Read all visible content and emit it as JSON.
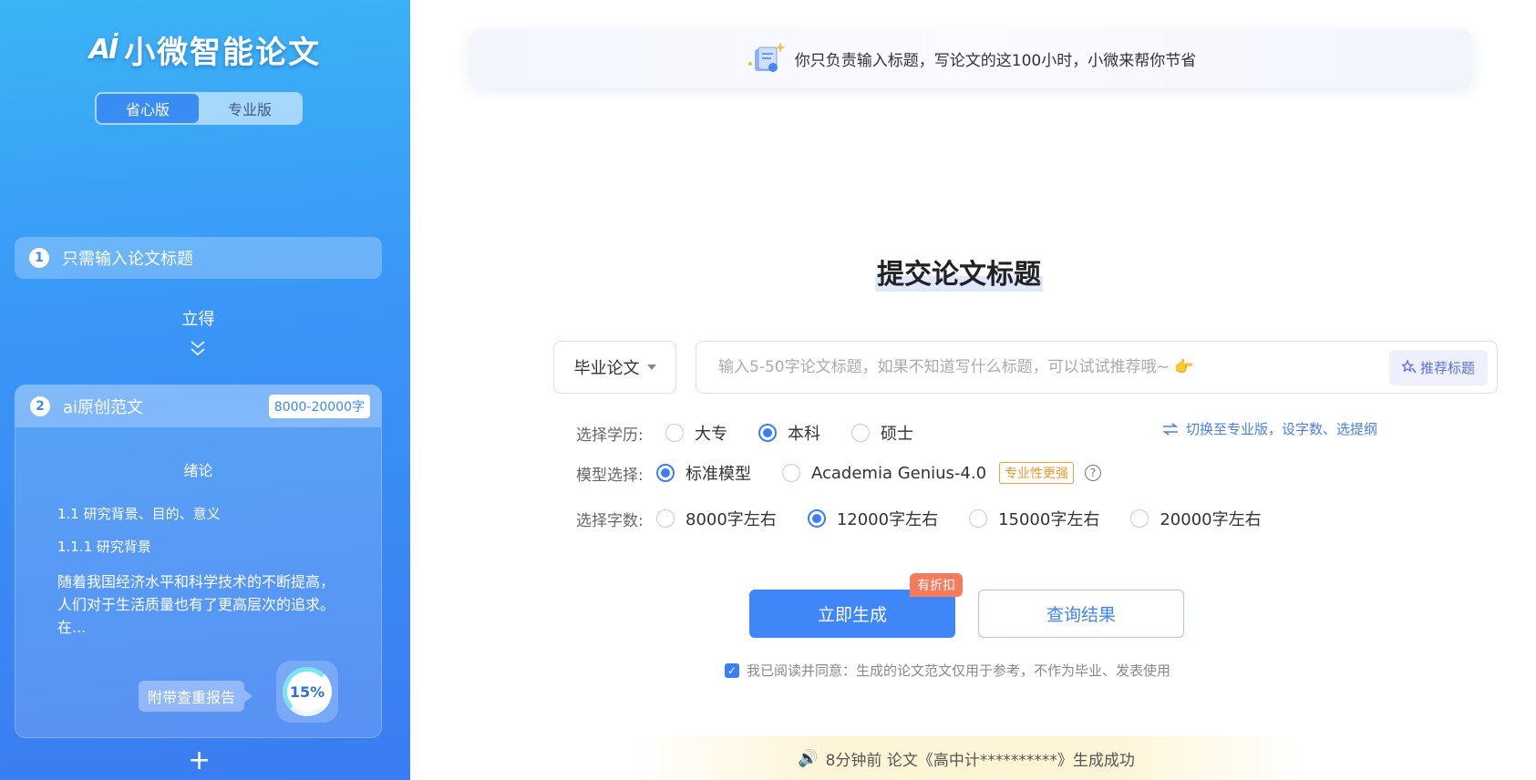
{
  "sidebar": {
    "brand": {
      "logo_text": "Aİ",
      "name": "小微智能论文"
    },
    "version_tabs": [
      "省心版",
      "专业版"
    ],
    "step1": {
      "num": "1",
      "label": "只需输入论文标题"
    },
    "result_text": "立得",
    "step2": {
      "num": "2",
      "label": "ai原创范文",
      "range": "8000-20000字",
      "doc_title": "绪论",
      "h1": "1.1 研究背景、目的、意义",
      "h2": "1.1.1 研究背景",
      "body_1": "随着我国经济水平和科学技术的不断提高，",
      "body_2": "人们对于生活质量也有了更高层次的追求。",
      "body_3": "在...",
      "report_tag": "附带查重报告",
      "percent": "15%"
    },
    "plus": "+"
  },
  "banner": {
    "text": "你只负责输入标题，写论文的这100小时，小微来帮你节省"
  },
  "main": {
    "title": "提交论文标题",
    "type_select": "毕业论文",
    "title_input_placeholder": "输入5-50字论文标题，如果不知道写什么标题，可以试试推荐哦~ 👉",
    "recommend_btn": "推荐标题",
    "education": {
      "label": "选择学历:",
      "options": [
        "大专",
        "本科",
        "硕士"
      ],
      "selected": "本科"
    },
    "switch_link": "切换至专业版，设字数、选提纲",
    "model": {
      "label": "模型选择:",
      "options": [
        "标准模型",
        "Academia Genius-4.0"
      ],
      "selected": "标准模型",
      "tag": "专业性更强"
    },
    "words": {
      "label": "选择字数:",
      "options": [
        "8000字左右",
        "12000字左右",
        "15000字左右",
        "20000字左右"
      ],
      "selected": "12000字左右"
    },
    "generate_btn": "立即生成",
    "discount_badge": "有折扣",
    "query_btn": "查询结果",
    "agreement": "我已阅读并同意：生成的论文范文仅用于参考，不作为毕业、发表使用",
    "notice": "8分钟前 论文《高中计**********》生成成功"
  },
  "colors": {
    "accent": "#3f86f8",
    "sidebar_top": "#3bb4f6",
    "sidebar_bottom": "#3b7cf2",
    "discount": "#f57b5c",
    "tag_orange": "#f0962b"
  }
}
